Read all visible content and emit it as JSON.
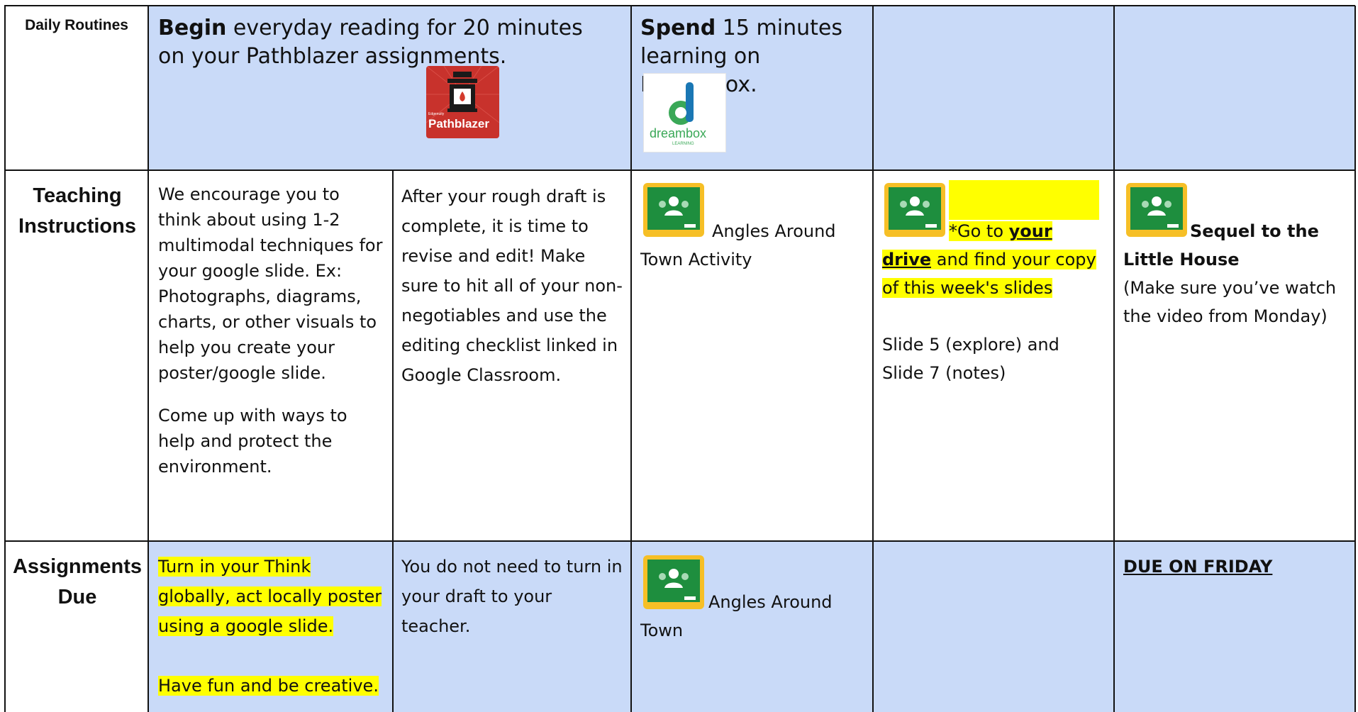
{
  "rows": {
    "daily_routines": {
      "header": "Daily Routines",
      "reading": {
        "bold": "Begin",
        "text": " everyday reading for 20 minutes on your Pathblazer assignments.",
        "logo_text": "Pathblazer",
        "logo_small": "Edgenuity"
      },
      "dreambox": {
        "bold": "Spend",
        "text": " 15 minutes learning on Dreambox.",
        "logo_text": "dreambox",
        "logo_sub": "LEARNING"
      }
    },
    "teaching": {
      "header": "Teaching Instructions",
      "col1_p1": "We encourage you to think about using 1-2 multimodal techniques for your google slide. Ex: Photographs, diagrams, charts, or other visuals to help you create your poster/google slide.",
      "col1_p2": "Come up with ways to help and protect the environment.",
      "col2": "After your rough draft is complete, it is time to revise and edit!  Make sure to hit all of your non-negotiables and use the editing checklist linked in Google Classroom.",
      "col3": "Angles Around Town Activity",
      "col4_pre": "*Go to ",
      "col4_link": "your drive",
      "col4_post": " and find your copy of this week's slides",
      "col4_p2": "Slide 5 (explore) and Slide 7 (notes)",
      "col5_title": "Sequel to the Little House",
      "col5_note": "(Make sure you’ve watch the video from Monday)"
    },
    "assignments": {
      "header": "Assignments Due",
      "col1_p1": "Turn in your Think globally, act locally poster using a google slide.",
      "col1_p2": "Have fun and be creative.",
      "col2": "You do not need to turn in your draft to your teacher.",
      "col3": "Angles Around Town",
      "col5": "DUE ON FRIDAY"
    }
  },
  "colors": {
    "band": "#c9daf8",
    "highlight": "#ffff00",
    "classroom_green": "#1e8e3e",
    "classroom_yellow": "#f6bf26"
  }
}
